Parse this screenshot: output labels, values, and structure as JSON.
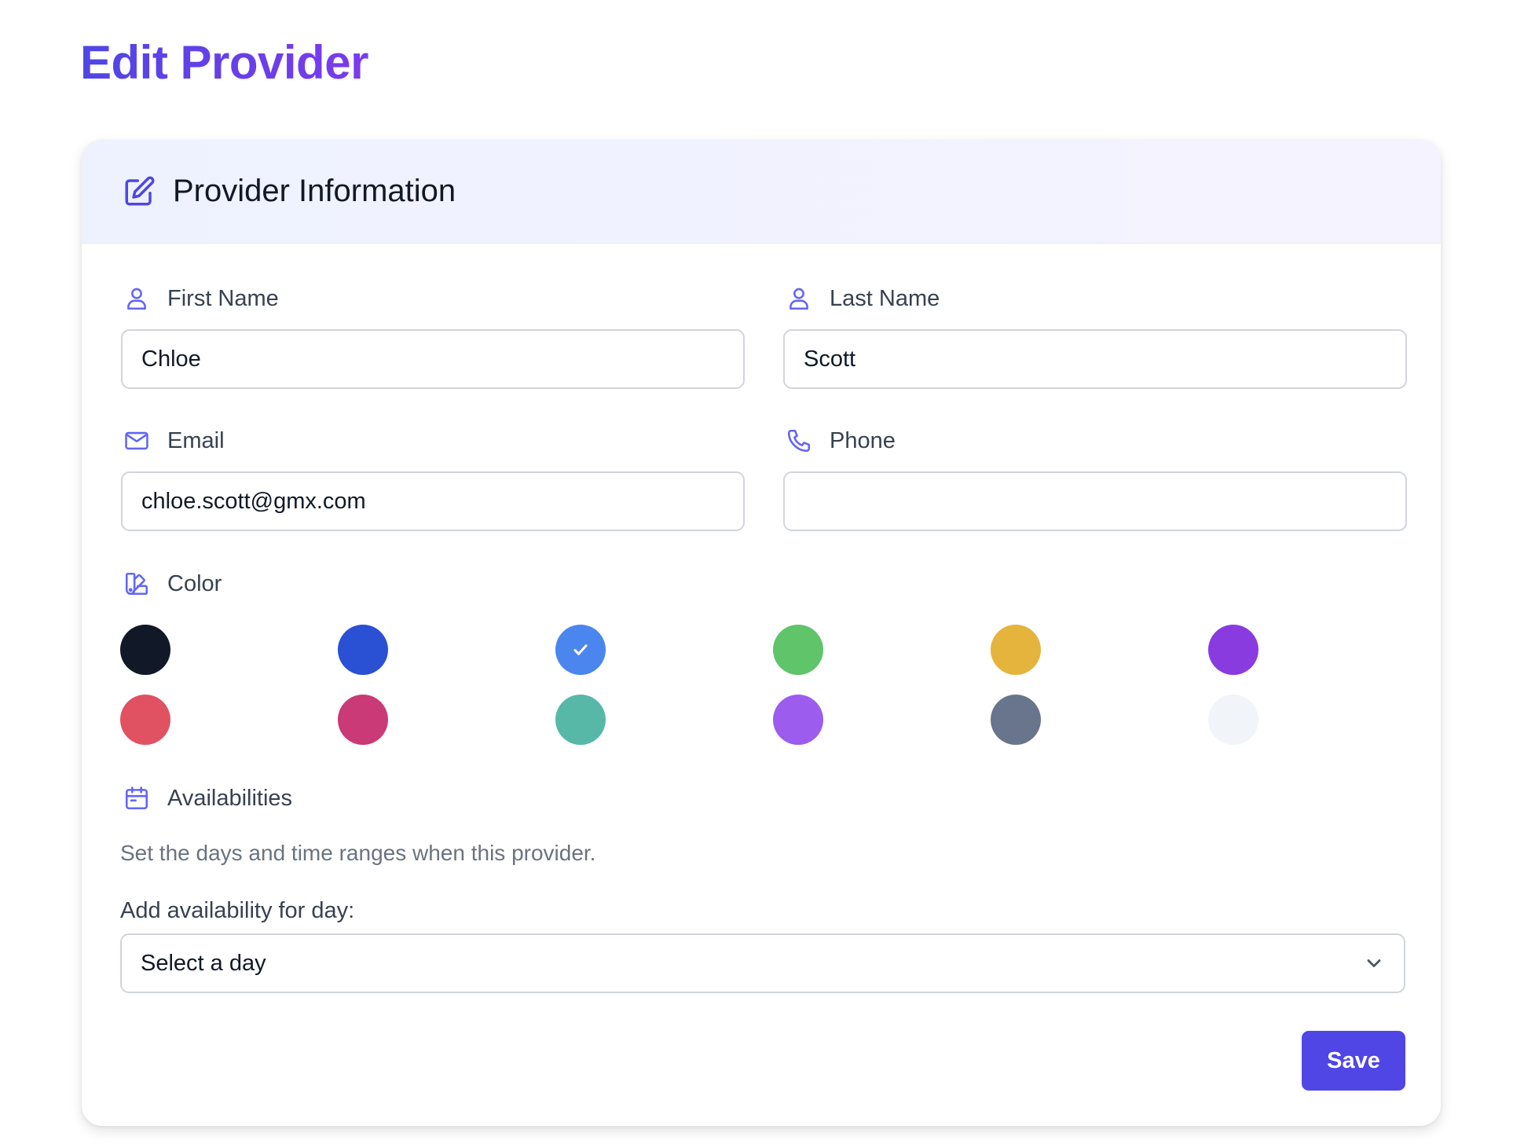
{
  "page": {
    "title": "Edit Provider"
  },
  "card": {
    "title": "Provider Information",
    "icon": "edit-square-icon"
  },
  "fields": {
    "first_name": {
      "label": "First Name",
      "value": "Chloe",
      "icon": "user-icon"
    },
    "last_name": {
      "label": "Last Name",
      "value": "Scott",
      "icon": "user-icon"
    },
    "email": {
      "label": "Email",
      "value": "chloe.scott@gmx.com",
      "icon": "mail-icon"
    },
    "phone": {
      "label": "Phone",
      "value": "",
      "icon": "phone-icon"
    }
  },
  "color": {
    "label": "Color",
    "icon": "swatch-icon",
    "options": [
      "#111827",
      "#2a50d4",
      "#4a86ee",
      "#5fc46a",
      "#e4b43c",
      "#8a3be0",
      "#e05262",
      "#c93a76",
      "#57b8a8",
      "#9c5ced",
      "#68758d",
      "#f1f4f9"
    ],
    "selected_index": 2
  },
  "availabilities": {
    "label": "Availabilities",
    "icon": "calendar-icon",
    "helper": "Set the days and time ranges when this provider.",
    "day_label": "Add availability for day:",
    "day_select_value": "Select a day"
  },
  "actions": {
    "save_label": "Save"
  },
  "colors": {
    "accent": "#4f46e5",
    "icon": "#6366f1"
  }
}
